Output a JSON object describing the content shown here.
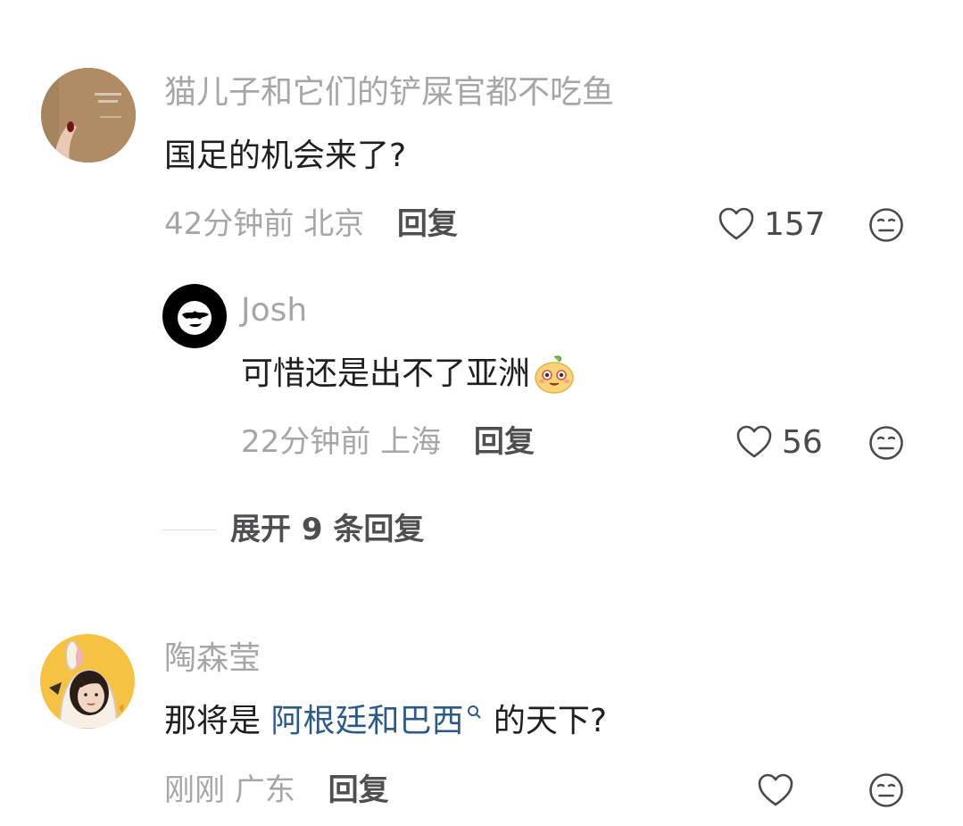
{
  "comments": [
    {
      "username": "猫儿子和它们的铲屎官都不吃鱼",
      "text": "国足的机会来了?",
      "time": "42分钟前",
      "location": "北京",
      "reply_label": "回复",
      "likes": "157",
      "replies": [
        {
          "username": "Josh",
          "text": "可惜还是出不了亚洲",
          "emoji": "face-emoji",
          "time": "22分钟前",
          "location": "上海",
          "reply_label": "回复",
          "likes": "56"
        }
      ],
      "expand_label": "展开 9 条回复"
    },
    {
      "username": "陶森莹",
      "text_before": "那将是 ",
      "link_text": "阿根廷和巴西",
      "link_icon": "search-icon",
      "text_after": " 的天下?",
      "time": "刚刚",
      "location": "广东",
      "reply_label": "回复",
      "likes": ""
    }
  ],
  "colors": {
    "username": "#a6a6a8",
    "content": "#1f1f1f",
    "link": "#2c5a86",
    "meta": "#a6a6a8",
    "reply": "#4f4f52"
  }
}
